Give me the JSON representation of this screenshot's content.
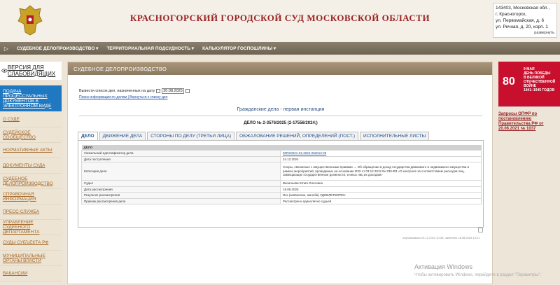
{
  "header": {
    "title": "КРАСНОГОРСКИЙ ГОРОДСКОЙ СУД МОСКОВСКОЙ ОБЛАСТИ",
    "address_lines": [
      "143403, Московская обл.,",
      "г. Красногорск,",
      "ул. Первомайская, д. 6",
      "ул. Речная, д. 20, корп. 1"
    ],
    "expand_label": "развернуть"
  },
  "topnav": {
    "home": "▷",
    "items": [
      "СУДЕБНОЕ ДЕЛОПРОИЗВОДСТВО ▾",
      "ТЕРРИТОРИАЛЬНАЯ ПОДСУДНОСТЬ ▾",
      "КАЛЬКУЛЯТОР ГОСПОШЛИНЫ ▾"
    ]
  },
  "vision": {
    "label": "ВЕРСИЯ ДЛЯ СЛАБОВИДЯЩИХ"
  },
  "sidebar": {
    "items": [
      "ПОДАЧА ПРОЦЕССУАЛЬНЫХ ДОКУМЕНТОВ В ЭЛЕКТРОННОМ ВИДЕ",
      "О СУДЕ",
      "СУДЕЙСКОЕ СООБЩЕСТВО",
      "НОРМАТИВНЫЕ АКТЫ",
      "ДОКУМЕНТЫ СУДА",
      "СУДЕБНОЕ ДЕЛОПРОИЗВОДСТВО",
      "СПРАВОЧНАЯ ИНФОРМАЦИЯ",
      "ПРЕСС-СЛУЖБА",
      "УПРАВЛЕНИЕ СУДЕБНОГО ДЕПАРТАМЕНТА",
      "СУДЫ СУБЪЕКТА РФ",
      "МУНИЦИПАЛЬНЫЕ ОРГАНЫ ВЛАСТИ",
      "ВАКАНСИИ"
    ]
  },
  "panel": {
    "title": "СУДЕБНОЕ ДЕЛОПРОИЗВОДСТВО",
    "date_label": "Вывести список дел, назначенных на дату",
    "date_value": "20.08.2025",
    "links": "Поиск информации по делам | Вернуться к списку дел",
    "case_header": "Гражданские дела - первая инстанция",
    "case_number": "ДЕЛО № 2-3576/2025 (2-17556/2024;)",
    "tabs": [
      "ДЕЛО",
      "ДВИЖЕНИЕ ДЕЛА",
      "СТОРОНЫ ПО ДЕЛУ (ТРЕТЬИ ЛИЦА)",
      "ОБЖАЛОВАНИЕ РЕШЕНИЙ, ОПРЕДЕЛЕНИЙ (ПОСТ.)",
      "ИСПОЛНИТЕЛЬНЫЕ ЛИСТЫ"
    ],
    "table_header": "ДЕЛО",
    "rows": [
      {
        "label": "Уникальный идентификатор дела",
        "value": "50RS0021-01-2024-002013-28"
      },
      {
        "label": "Дата поступления",
        "value": "24.12.2024"
      },
      {
        "label": "Категория дела",
        "value": "Споры, связанные с имущественными правами → Об обращении в доход государства движимого и недвижимого имущества в рамках мероприятий, проводимых на основании Ф32 от 03.12.2012 № 230-ФЗ «О контроле за соответствием расходов лиц, замещающих государственные должности, и иных лиц их доходам»"
      },
      {
        "label": "Судья",
        "value": "Васильева Юлия Олеговна"
      },
      {
        "label": "Дата рассмотрения",
        "value": "18.08.2025"
      },
      {
        "label": "Результат рассмотрения",
        "value": "Иск (заявление, жалоба) УДОВЛЕТВОРЕН"
      },
      {
        "label": "Признак рассмотрения дела",
        "value": "Рассмотрено единолично судьей"
      }
    ],
    "published": "опубликовано 24.12.2024 10:38, изменено 18.08.2025 10:21"
  },
  "right": {
    "banner_lines": [
      "9 МАЯ",
      "День Победы",
      "в Великой",
      "Отечественной войне",
      "1941–1945 годов"
    ],
    "banner_big": "80",
    "link": "Запросы ОПФР по постановлению Правительства РФ от 20.06.2021 № 1037"
  },
  "watermark": {
    "line1": "Активация Windows",
    "line2": "Чтобы активировать Windows, перейдите в раздел \"Параметры\"."
  }
}
